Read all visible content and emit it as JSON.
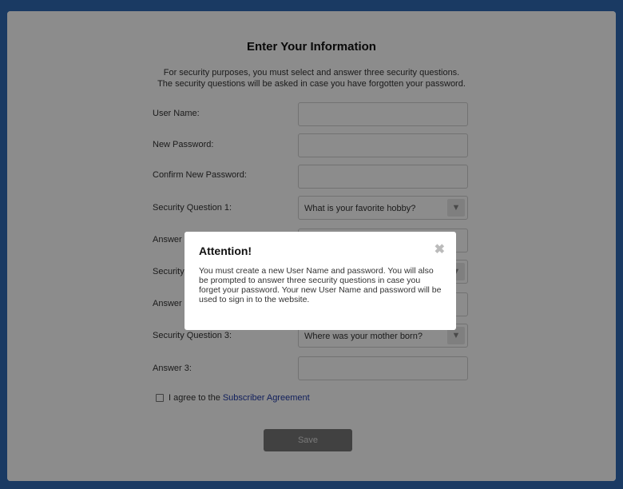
{
  "form": {
    "title": "Enter Your Information",
    "intro_line1": "For security purposes, you must select and answer three security questions.",
    "intro_line2": "The security questions will be asked in case you have forgotten your password.",
    "labels": {
      "user_name": "User Name:",
      "new_password": "New Password:",
      "confirm_password": "Confirm New Password:",
      "sq1": "Security Question 1:",
      "answer1": "Answer 1:",
      "sq2": "Security Question 2:",
      "answer2": "Answer 2:",
      "sq3": "Security Question 3:",
      "answer3": "Answer 3:"
    },
    "selects": {
      "sq1_value": "What is your favorite hobby?",
      "sq3_value": "Where was your mother born?"
    },
    "agree_text": "I agree to the",
    "agree_link": "Subscriber Agreement",
    "save_label": "Save"
  },
  "modal": {
    "title": "Attention!",
    "close_glyph": "✖",
    "body": "You must create a new User Name and password. You will also be prompted to answer three security questions in case you forget your password. Your new User Name and password will be used to sign in to the website."
  },
  "icons": {
    "select_arrow": "arrow-down-icon",
    "close": "close-icon"
  }
}
